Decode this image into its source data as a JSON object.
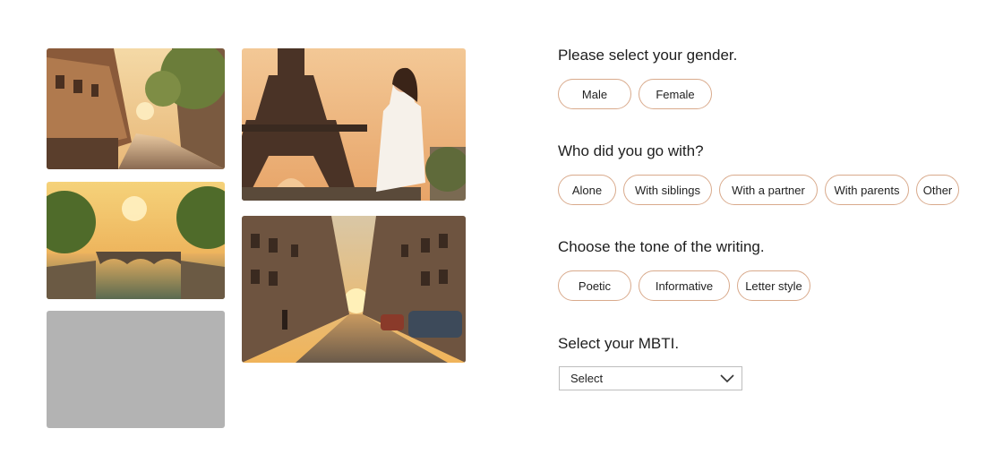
{
  "questions": {
    "gender": {
      "label": "Please select your gender.",
      "options": [
        "Male",
        "Female"
      ]
    },
    "companion": {
      "label": "Who did you go with?",
      "options": [
        "Alone",
        "With siblings",
        "With a partner",
        "With parents",
        "Other"
      ]
    },
    "tone": {
      "label": "Choose the tone of the writing.",
      "options": [
        "Poetic",
        "Informative",
        "Letter style"
      ]
    },
    "mbti": {
      "label": "Select your MBTI.",
      "selected": "Select"
    }
  },
  "colors": {
    "pill_border": "#d9aa8c",
    "placeholder_photo": "#b3b3b3"
  },
  "icons": {
    "dropdown": "chevron-down-icon"
  }
}
